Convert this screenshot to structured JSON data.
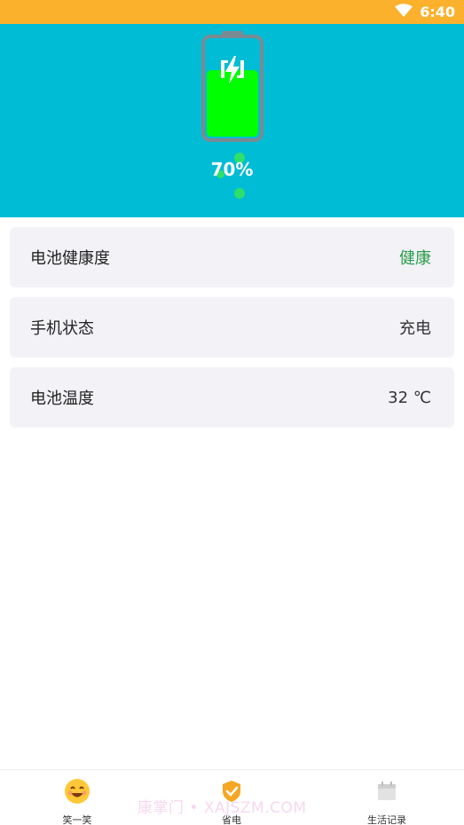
{
  "status_bar": {
    "time": "6:40"
  },
  "battery": {
    "percent_text": "70%",
    "level": 0.7
  },
  "cards": [
    {
      "label": "电池健康度",
      "value": "健康"
    },
    {
      "label": "手机状态",
      "value": "充电"
    },
    {
      "label": "电池温度",
      "value": "32 ℃"
    }
  ],
  "nav": {
    "items": [
      {
        "label": "笑一笑",
        "icon": "smile-face-icon"
      },
      {
        "label": "省电",
        "icon": "shield-check-icon"
      },
      {
        "label": "生活记录",
        "icon": "calendar-icon"
      }
    ]
  },
  "watermark": "康掌门 • XAJSZM.COM",
  "colors": {
    "status_bar": "#fbb12c",
    "header": "#00bcd4",
    "battery_fill": "#00ff00",
    "health_good": "#2a9d4b",
    "card_bg": "#f3f2f7"
  }
}
